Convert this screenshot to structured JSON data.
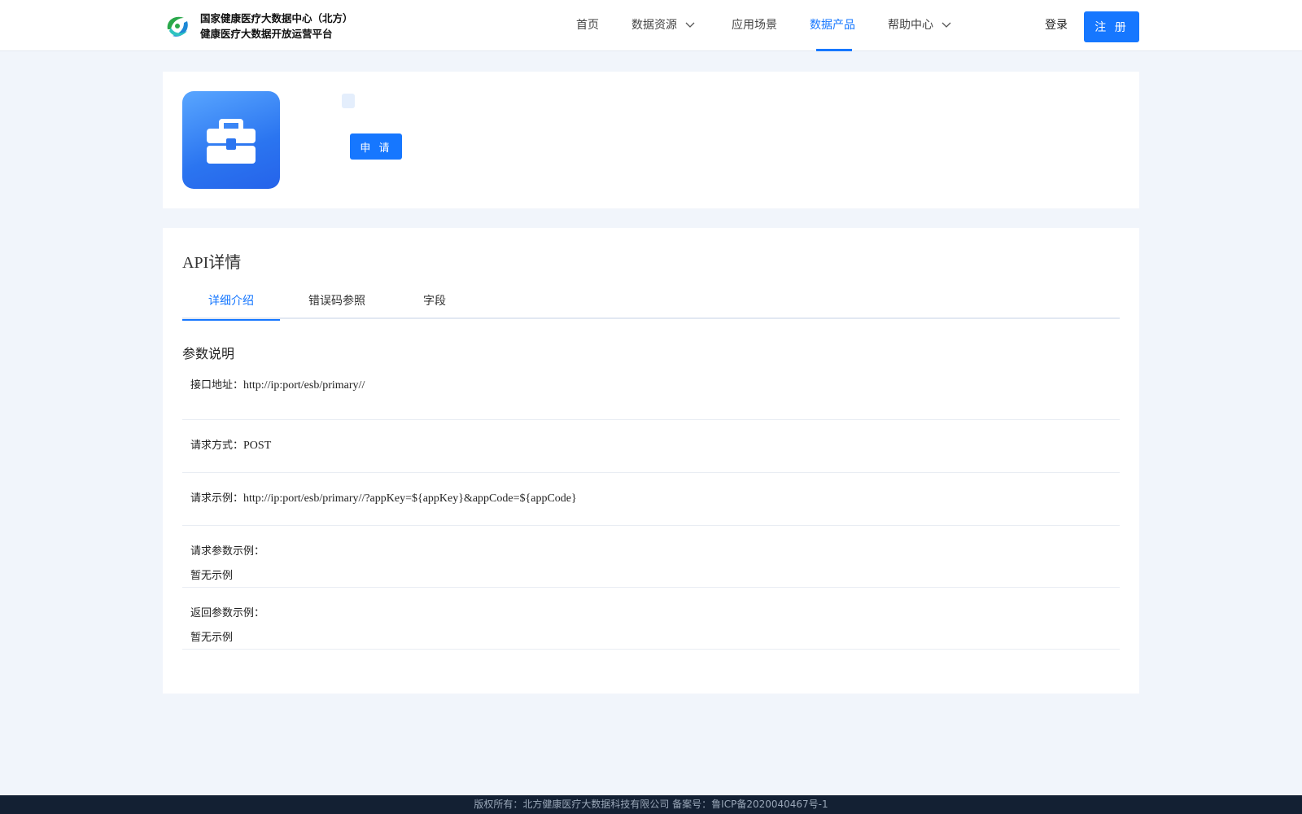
{
  "header": {
    "brand_line1": "国家健康医疗大数据中心（北方）",
    "brand_line2": "健康医疗大数据开放运营平台",
    "nav": [
      {
        "label": "首页"
      },
      {
        "label": "数据资源"
      },
      {
        "label": "应用场景"
      },
      {
        "label": "数据产品"
      },
      {
        "label": "帮助中心"
      }
    ],
    "active_nav": "数据产品",
    "login": "登录",
    "register": "注 册"
  },
  "product": {
    "icon": "briefcase-icon",
    "apply": "申 请"
  },
  "api": {
    "title": "API详情",
    "tabs": [
      {
        "label": "详细介绍"
      },
      {
        "label": "错误码参照"
      },
      {
        "label": "字段"
      }
    ],
    "active_tab": "详细介绍",
    "section": "参数说明",
    "rows": [
      {
        "label": "接口地址：",
        "value": "http://ip:port/esb/primary//"
      },
      {
        "label": "请求方式：",
        "value": "POST"
      },
      {
        "label": "请求示例：",
        "value": "http://ip:port/esb/primary//?appKey=${appKey}&appCode=${appCode}"
      },
      {
        "label": "请求参数示例：",
        "value": "暂无示例"
      },
      {
        "label": "返回参数示例：",
        "value": "暂无示例"
      }
    ]
  },
  "footer": {
    "text": "版权所有：北方健康医疗大数据科技有限公司 备案号：鲁ICP备2020040467号-1"
  },
  "colors": {
    "accent": "#1677ff",
    "page_bg": "#f1f5fb",
    "footer_bg": "#132033"
  }
}
